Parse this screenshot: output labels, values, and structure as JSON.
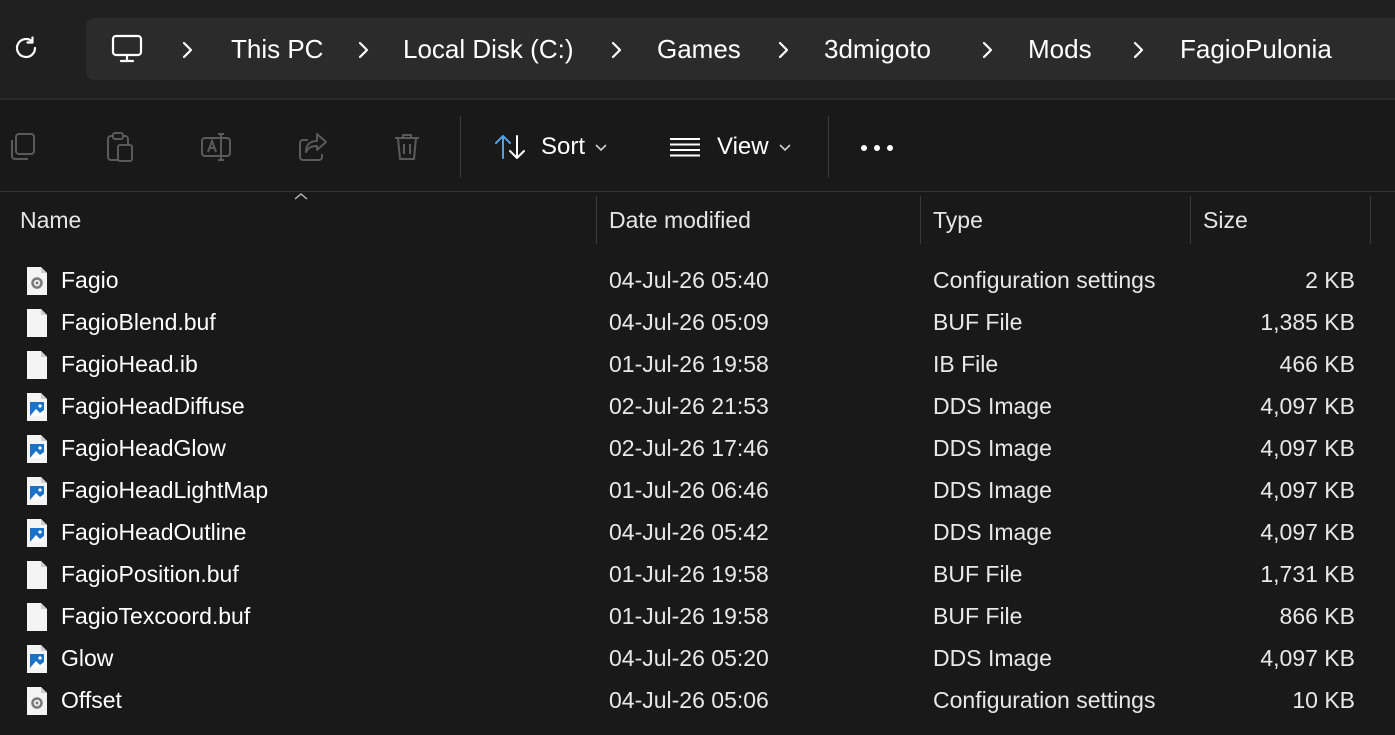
{
  "breadcrumb": {
    "items": [
      "This PC",
      "Local Disk (C:)",
      "Games",
      "3dmigoto",
      "Mods",
      "FagioPulonia"
    ]
  },
  "toolbar": {
    "sort_label": "Sort",
    "view_label": "View"
  },
  "columns": {
    "name": "Name",
    "date": "Date modified",
    "type": "Type",
    "size": "Size"
  },
  "files": [
    {
      "name": "Fagio",
      "date": "04-Jul-26 05:40",
      "type": "Configuration settings",
      "size": "2 KB",
      "icon": "config-file-icon"
    },
    {
      "name": "FagioBlend.buf",
      "date": "04-Jul-26 05:09",
      "type": "BUF File",
      "size": "1,385 KB",
      "icon": "file-icon"
    },
    {
      "name": "FagioHead.ib",
      "date": "01-Jul-26 19:58",
      "type": "IB File",
      "size": "466 KB",
      "icon": "file-icon"
    },
    {
      "name": "FagioHeadDiffuse",
      "date": "02-Jul-26 21:53",
      "type": "DDS Image",
      "size": "4,097 KB",
      "icon": "image-file-icon"
    },
    {
      "name": "FagioHeadGlow",
      "date": "02-Jul-26 17:46",
      "type": "DDS Image",
      "size": "4,097 KB",
      "icon": "image-file-icon"
    },
    {
      "name": "FagioHeadLightMap",
      "date": "01-Jul-26 06:46",
      "type": "DDS Image",
      "size": "4,097 KB",
      "icon": "image-file-icon"
    },
    {
      "name": "FagioHeadOutline",
      "date": "04-Jul-26 05:42",
      "type": "DDS Image",
      "size": "4,097 KB",
      "icon": "image-file-icon"
    },
    {
      "name": "FagioPosition.buf",
      "date": "01-Jul-26 19:58",
      "type": "BUF File",
      "size": "1,731 KB",
      "icon": "file-icon"
    },
    {
      "name": "FagioTexcoord.buf",
      "date": "01-Jul-26 19:58",
      "type": "BUF File",
      "size": "866 KB",
      "icon": "file-icon"
    },
    {
      "name": "Glow",
      "date": "04-Jul-26 05:20",
      "type": "DDS Image",
      "size": "4,097 KB",
      "icon": "image-file-icon"
    },
    {
      "name": "Offset",
      "date": "04-Jul-26 05:06",
      "type": "Configuration settings",
      "size": "10 KB",
      "icon": "config-file-icon"
    }
  ],
  "colors": {
    "background": "#191919",
    "addressbar": "#202020",
    "crumbbox": "#2b2b2b",
    "disabled_icon": "#5a5a5a",
    "accent_icon": "#4fa3e6",
    "image_icon": "#1a73c9"
  }
}
